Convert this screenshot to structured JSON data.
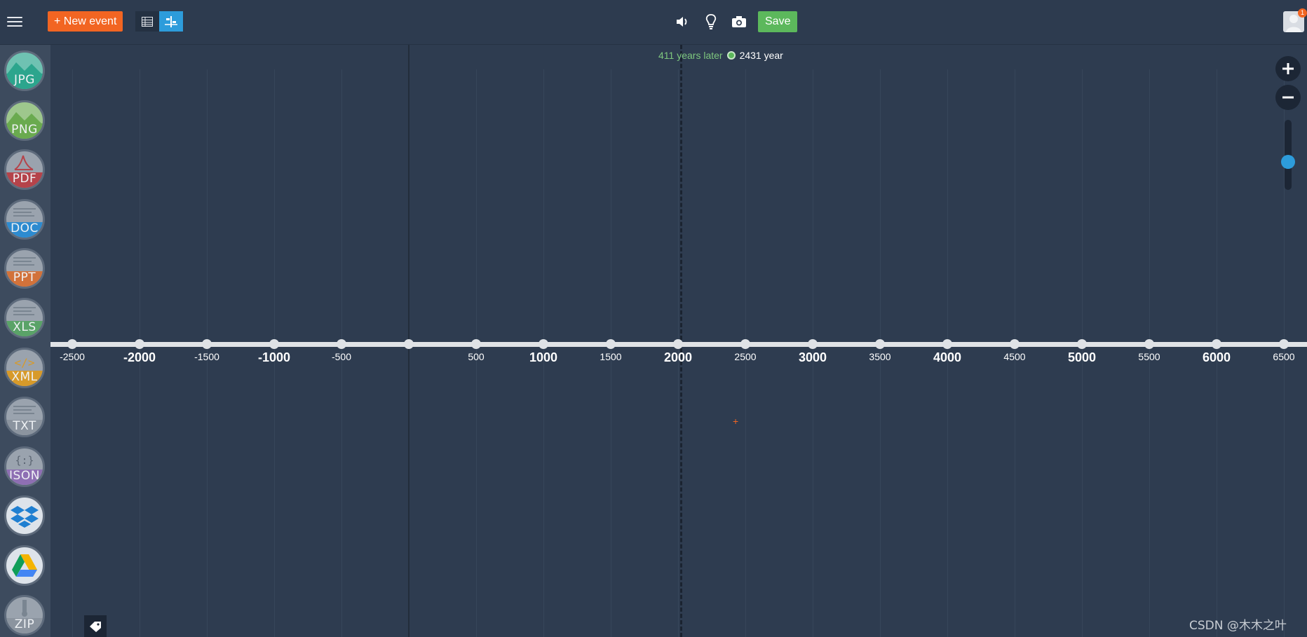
{
  "toolbar": {
    "new_event_label": "+ New event",
    "save_label": "Save",
    "notification_count": "1"
  },
  "sidebar": {
    "file_types": [
      {
        "label": "JPG",
        "color": "#2ca58d"
      },
      {
        "label": "PNG",
        "color": "#6aaa4f"
      },
      {
        "label": "PDF",
        "color": "#b5434a"
      },
      {
        "label": "DOC",
        "color": "#2d8bd0"
      },
      {
        "label": "PPT",
        "color": "#d2723a"
      },
      {
        "label": "XLS",
        "color": "#5aa368"
      },
      {
        "label": "XML",
        "color": "#d79a2a"
      },
      {
        "label": "TXT",
        "color": "#8b949f"
      },
      {
        "label": "JSON",
        "color": "#8e6fb3"
      },
      {
        "label": "",
        "icon": "dropbox-icon"
      },
      {
        "label": "",
        "icon": "google-drive-icon"
      },
      {
        "label": "ZIP",
        "color": "#8b949f"
      }
    ]
  },
  "timeline": {
    "now_offset_text": "411 years later",
    "now_year_text": "2431 year",
    "ticks": [
      {
        "value": -2500,
        "label": "-2500",
        "major": false
      },
      {
        "value": -2000,
        "label": "-2000",
        "major": true
      },
      {
        "value": -1500,
        "label": "-1500",
        "major": false
      },
      {
        "value": -1000,
        "label": "-1000",
        "major": true
      },
      {
        "value": -500,
        "label": "-500",
        "major": false
      },
      {
        "value": 0,
        "label": "",
        "major": false
      },
      {
        "value": 500,
        "label": "500",
        "major": false
      },
      {
        "value": 1000,
        "label": "1000",
        "major": true
      },
      {
        "value": 1500,
        "label": "1500",
        "major": false
      },
      {
        "value": 2000,
        "label": "2000",
        "major": true
      },
      {
        "value": 2500,
        "label": "2500",
        "major": false
      },
      {
        "value": 3000,
        "label": "3000",
        "major": true
      },
      {
        "value": 3500,
        "label": "3500",
        "major": false
      },
      {
        "value": 4000,
        "label": "4000",
        "major": true
      },
      {
        "value": 4500,
        "label": "4500",
        "major": false
      },
      {
        "value": 5000,
        "label": "5000",
        "major": true
      },
      {
        "value": 5500,
        "label": "5500",
        "major": false
      },
      {
        "value": 6000,
        "label": "6000",
        "major": true
      },
      {
        "value": 6500,
        "label": "6500",
        "major": false
      }
    ],
    "zoom_level_fraction": 0.6
  },
  "watermark": "CSDN @木木之叶",
  "colors": {
    "background": "#2e3c50",
    "accent_orange": "#f26522",
    "accent_green": "#5cb85c",
    "accent_blue": "#2d9cdb"
  }
}
